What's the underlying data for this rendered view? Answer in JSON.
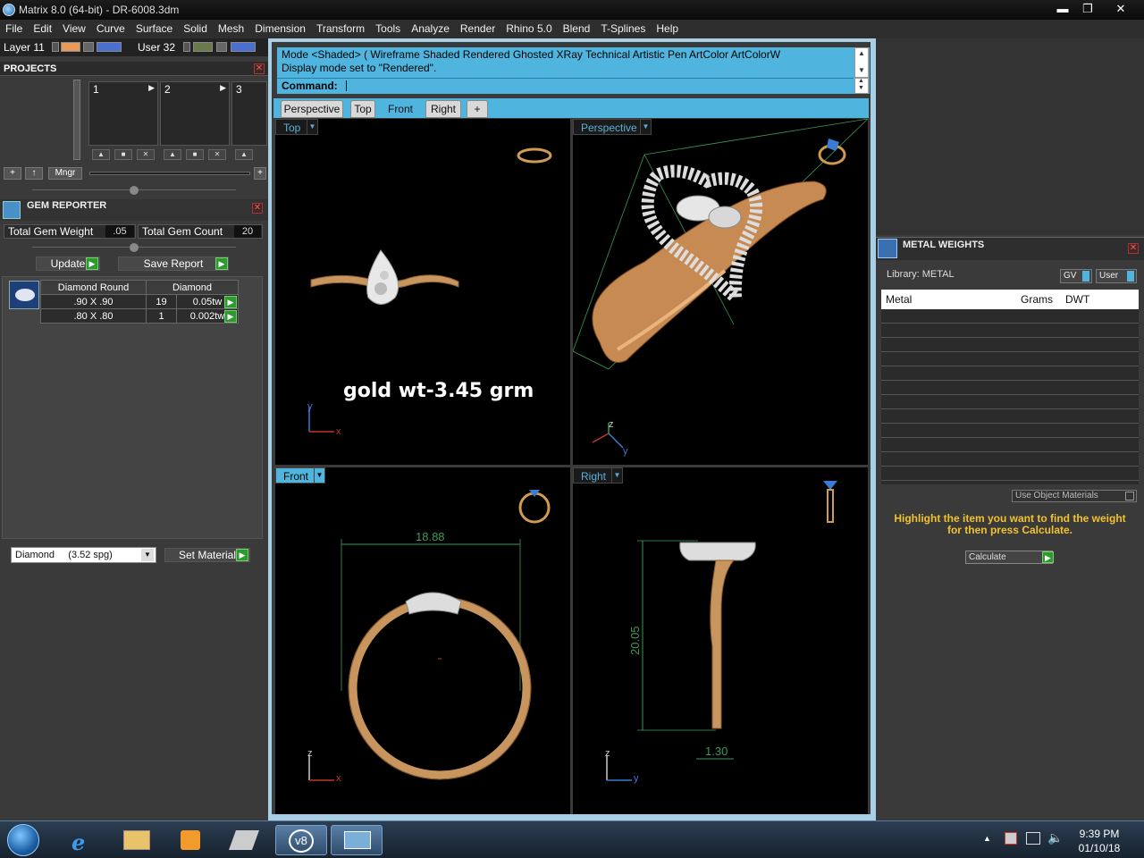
{
  "window": {
    "title": "Matrix 8.0 (64-bit) - DR-6008.3dm",
    "min": "▬",
    "max": "❐",
    "close": "✕"
  },
  "menu": [
    "File",
    "Edit",
    "View",
    "Curve",
    "Surface",
    "Solid",
    "Mesh",
    "Dimension",
    "Transform",
    "Tools",
    "Analyze",
    "Render",
    "Rhino 5.0",
    "Blend",
    "T-Splines",
    "Help"
  ],
  "layers": {
    "layer": "Layer 11",
    "user": "User 32"
  },
  "projects": {
    "title": "PROJECTS",
    "slots": [
      "1",
      "2",
      "3"
    ],
    "mngr": "Mngr"
  },
  "gem_reporter": {
    "title": "GEM REPORTER",
    "total_weight_label": "Total Gem Weight",
    "total_weight": ".05",
    "total_count_label": "Total Gem Count",
    "total_count": "20",
    "update": "Update",
    "save_report": "Save Report",
    "table_header": [
      "Diamond Round",
      "Diamond"
    ],
    "rows": [
      {
        "size": ".90 X .90",
        "count": "19",
        "tw": "0.05tw"
      },
      {
        "size": ".80 X .80",
        "count": "1",
        "tw": "0.002tw"
      }
    ],
    "material": "Diamond     (3.52 spg)",
    "set_material": "Set Material"
  },
  "command": {
    "line1": "Mode <Shaded> ( Wireframe  Shaded  Rendered  Ghosted  XRay  Technical  Artistic  Pen  ArtColor  ArtColorW",
    "line2": "Display mode set to \"Rendered\".",
    "prompt": "Command:"
  },
  "view_tabs": [
    "Perspective",
    "Top",
    "Front",
    "Right",
    "+"
  ],
  "active_tab": "Front",
  "viewports": {
    "top": {
      "label": "Top",
      "annotation": "gold wt-3.45 grm"
    },
    "perspective": {
      "label": "Perspective"
    },
    "front": {
      "label": "Front",
      "dimension": "18.88"
    },
    "right": {
      "label": "Right",
      "dim_height": "20.05",
      "dim_width": "1.30"
    },
    "axes": {
      "x": "x",
      "y": "y",
      "z": "z"
    }
  },
  "metal_weights": {
    "title": "METAL WEIGHTS",
    "library": "Library: METAL",
    "gv": "GV",
    "user": "User",
    "columns": [
      "Metal",
      "Grams",
      "DWT"
    ],
    "use_object_materials": "Use Object Materials",
    "hint": "Highlight the item you want to find the weight for then press Calculate.",
    "calculate": "Calculate"
  },
  "taskbar": {
    "time": "9:39 PM",
    "date": "01/10/18"
  }
}
